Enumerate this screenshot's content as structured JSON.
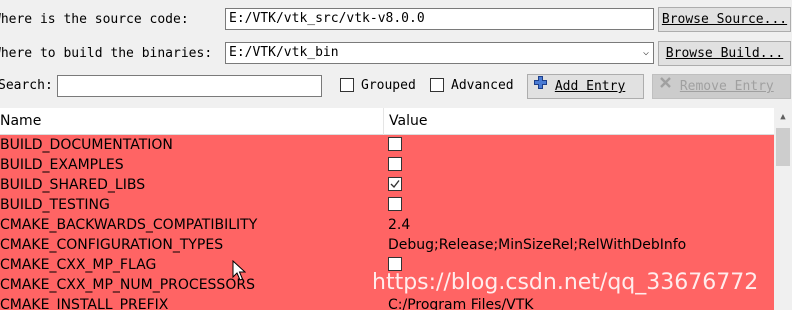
{
  "top": {
    "source_label": "Where is the source code:",
    "source_value": "E:/VTK/vtk_src/vtk-v8.0.0",
    "browse_source_label": "Browse Source...",
    "binaries_label": "Where to build the binaries:",
    "binaries_value": "E:/VTK/vtk_bin",
    "browse_build_label": "Browse Build...",
    "search_label": "Search:",
    "search_value": "",
    "grouped_label": "Grouped",
    "advanced_label": "Advanced",
    "add_entry_label": "Add Entry",
    "remove_entry_label": "Remove Entry"
  },
  "table": {
    "columns": [
      "Name",
      "Value"
    ],
    "rows": [
      {
        "name": "BUILD_DOCUMENTATION",
        "type": "bool",
        "checked": false
      },
      {
        "name": "BUILD_EXAMPLES",
        "type": "bool",
        "checked": false
      },
      {
        "name": "BUILD_SHARED_LIBS",
        "type": "bool",
        "checked": true
      },
      {
        "name": "BUILD_TESTING",
        "type": "bool",
        "checked": false
      },
      {
        "name": "CMAKE_BACKWARDS_COMPATIBILITY",
        "type": "text",
        "value": "2.4"
      },
      {
        "name": "CMAKE_CONFIGURATION_TYPES",
        "type": "text",
        "value": "Debug;Release;MinSizeRel;RelWithDebInfo"
      },
      {
        "name": "CMAKE_CXX_MP_FLAG",
        "type": "bool",
        "checked": false
      },
      {
        "name": "CMAKE_CXX_MP_NUM_PROCESSORS",
        "type": "text",
        "value": ""
      },
      {
        "name": "CMAKE_INSTALL_PREFIX",
        "type": "text",
        "value": "C:/Program Files/VTK"
      }
    ]
  },
  "colors": {
    "row_highlight": "#ff6464",
    "window_bg": "#f0f0f0"
  },
  "watermark": "https://blog.csdn.net/qq_33676772"
}
